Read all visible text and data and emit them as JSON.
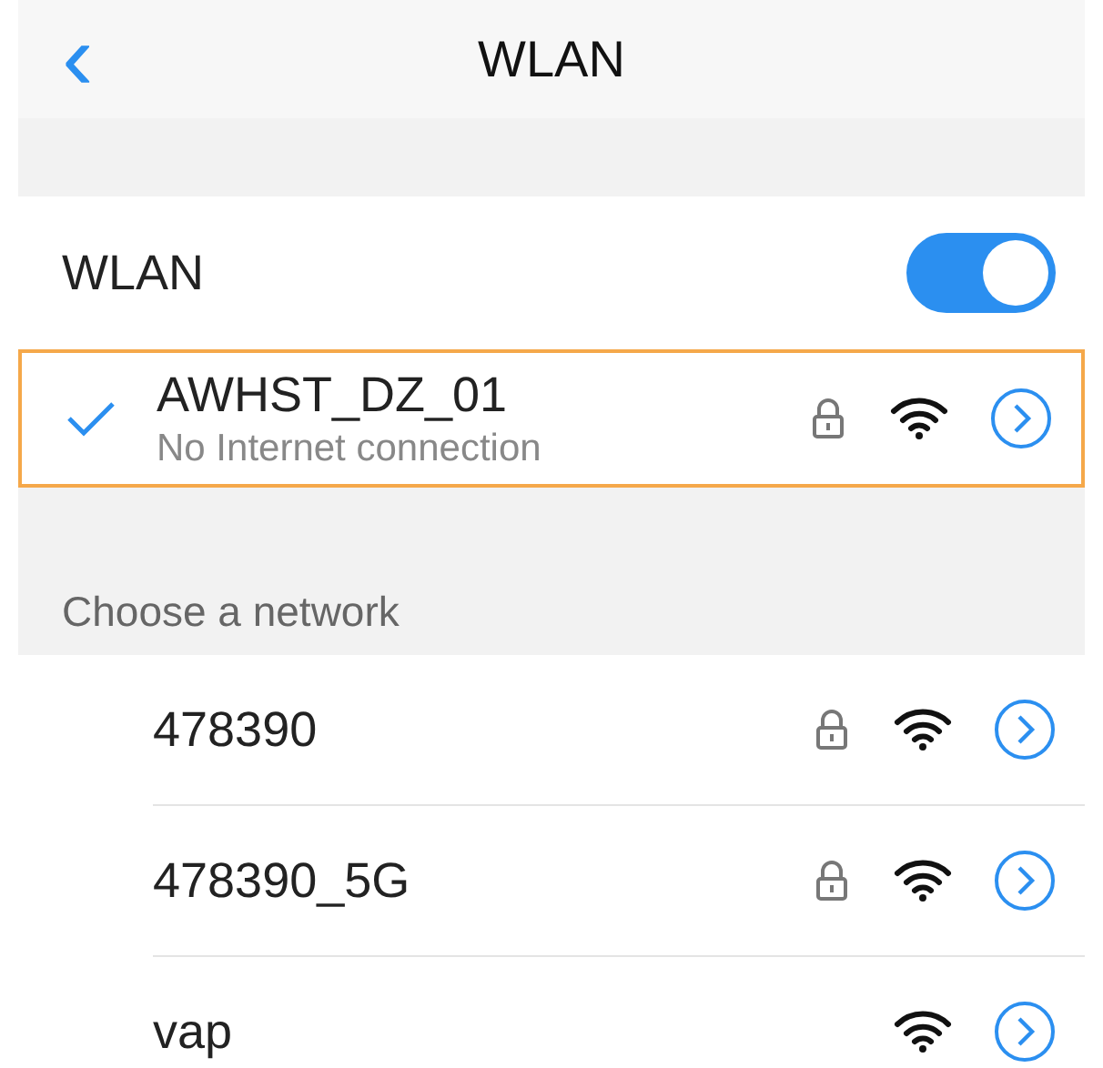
{
  "nav": {
    "back": "‹",
    "title": "WLAN"
  },
  "wlan": {
    "label": "WLAN",
    "on": true
  },
  "connected": {
    "name": "AWHST_DZ_01",
    "status": "No Internet connection",
    "checked": true,
    "locked": true,
    "highlighted": true
  },
  "section": {
    "title": "Choose a network"
  },
  "networks": [
    {
      "name": "478390",
      "locked": true
    },
    {
      "name": "478390_5G",
      "locked": true
    },
    {
      "name": "vap",
      "locked": false
    }
  ]
}
